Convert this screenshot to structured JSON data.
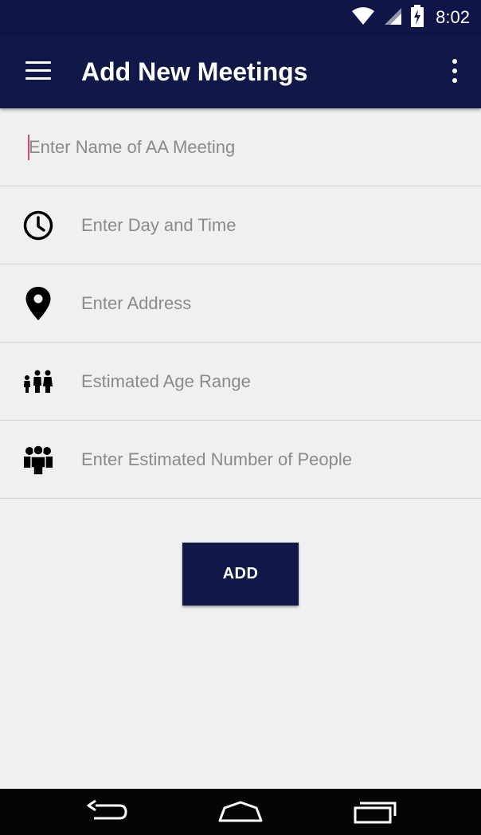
{
  "status_bar": {
    "time": "8:02",
    "icons": [
      "wifi-icon",
      "signal-icon",
      "battery-charging-icon"
    ]
  },
  "app_bar": {
    "title": "Add New Meetings",
    "icons": [
      "menu-icon",
      "overflow-menu-icon"
    ]
  },
  "form": {
    "fields": [
      {
        "placeholder": "Enter Name of AA Meeting",
        "value": "",
        "icon": ""
      },
      {
        "placeholder": "Enter Day and Time",
        "value": "",
        "icon": "clock-icon"
      },
      {
        "placeholder": "Enter Address",
        "value": "",
        "icon": "location-pin-icon"
      },
      {
        "placeholder": "Estimated Age Range",
        "value": "",
        "icon": "family-icon"
      },
      {
        "placeholder": "Enter Estimated Number of People",
        "value": "",
        "icon": "group-icon"
      }
    ]
  },
  "actions": {
    "add_label": "ADD"
  },
  "nav_bar": {
    "icons": [
      "back-icon",
      "home-icon",
      "recents-icon"
    ]
  },
  "colors": {
    "primary": "#101848",
    "background": "#f0f0f0",
    "cursor": "#e0457b",
    "placeholder": "#8a8a8a"
  }
}
